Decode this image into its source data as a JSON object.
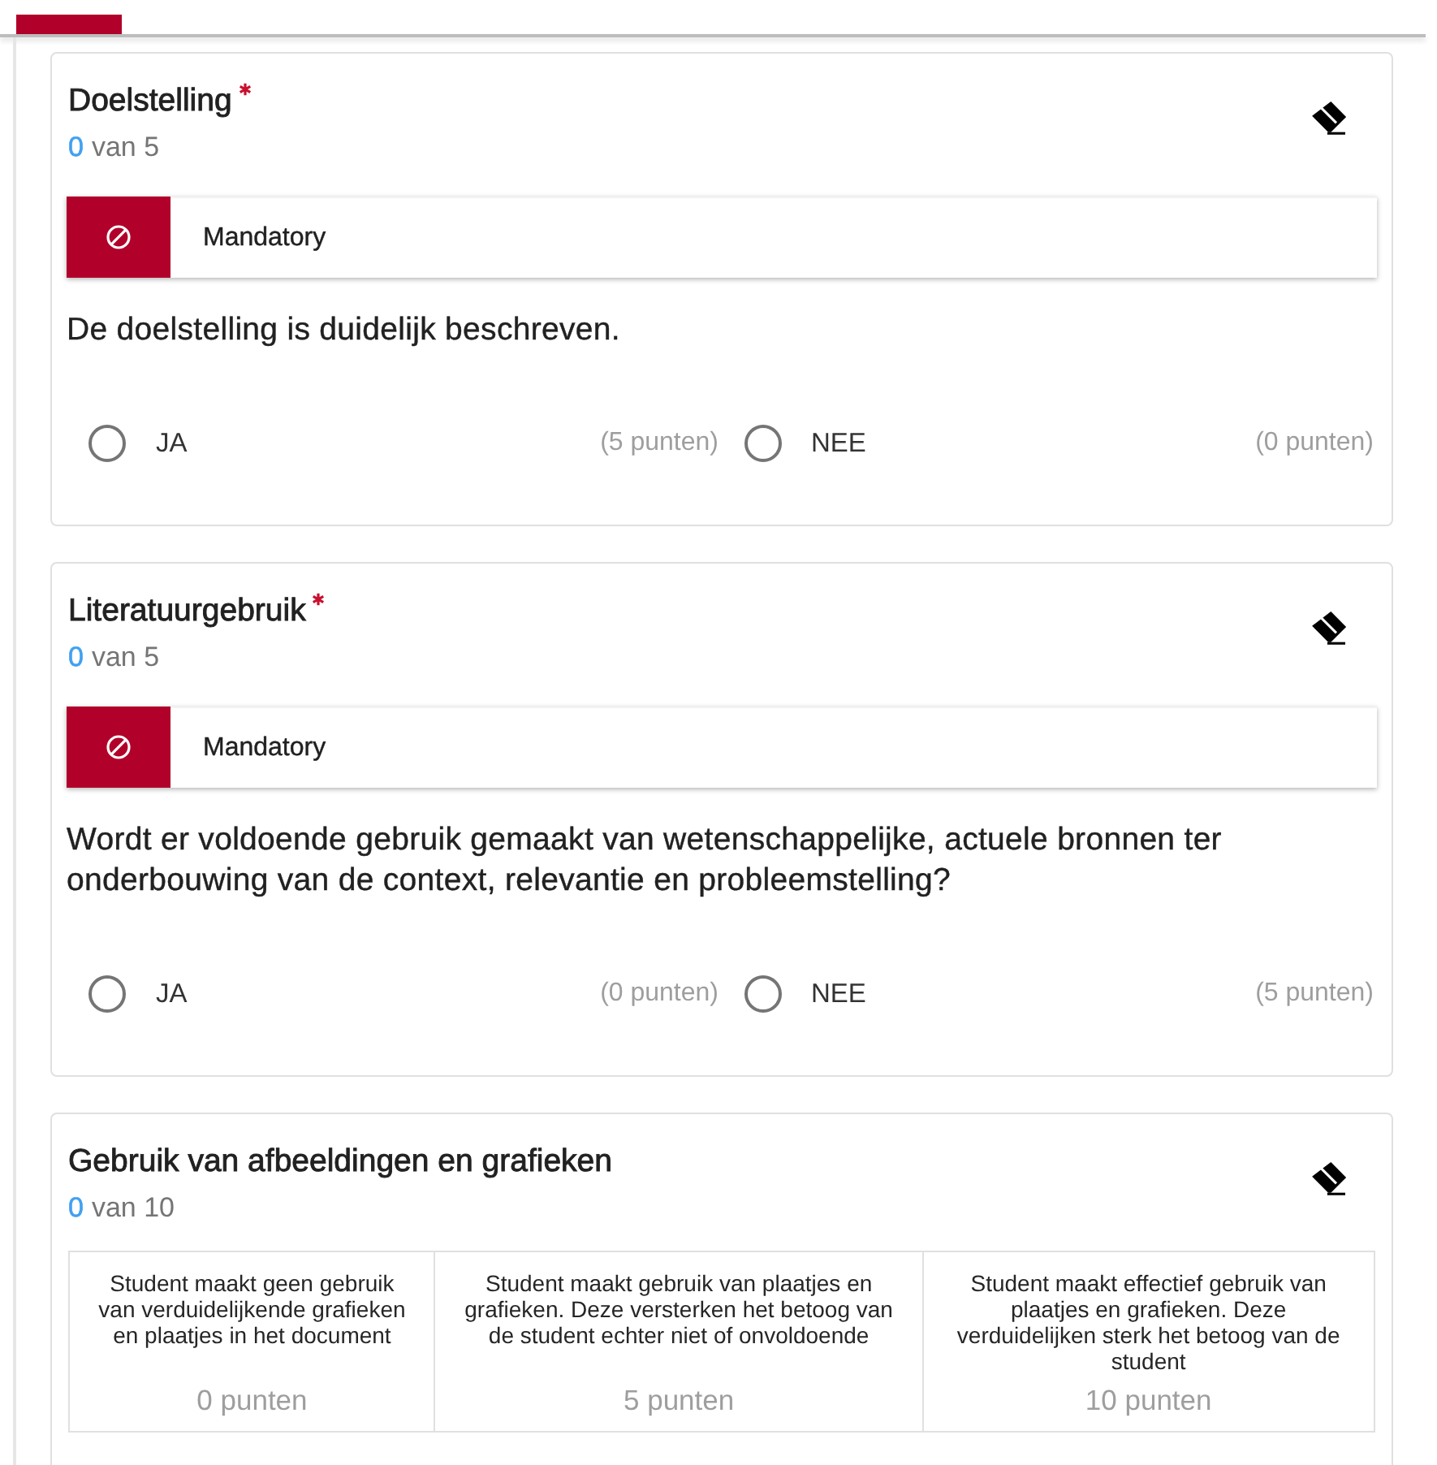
{
  "criteria": [
    {
      "kind": "radio",
      "title": "Doelstelling",
      "required": true,
      "score": "0",
      "max_score": "van 5",
      "notice": "Mandatory",
      "question": "De doelstelling is duidelijk beschreven.",
      "options": [
        {
          "label": "JA",
          "points": "(5 punten)",
          "selected": false
        },
        {
          "label": "NEE",
          "points": "(0 punten)",
          "selected": false
        }
      ]
    },
    {
      "kind": "radio",
      "title": "Literatuurgebruik",
      "required": true,
      "score": "0",
      "max_score": "van 5",
      "notice": "Mandatory",
      "question": "Wordt er voldoende gebruik gemaakt van wetenschappelijke, actuele bronnen ter onderbouwing van de context, relevantie en probleemstelling?",
      "options": [
        {
          "label": "JA",
          "points": "(0 punten)",
          "selected": false
        },
        {
          "label": "NEE",
          "points": "(5 punten)",
          "selected": false
        }
      ]
    },
    {
      "kind": "rubric",
      "title": "Gebruik van afbeeldingen en grafieken",
      "required": false,
      "score": "0",
      "max_score": "van 10",
      "levels": [
        {
          "description": "Student maakt geen gebruik van verduidelijkende grafieken en plaatjes in het document",
          "points": "0 punten",
          "selected": false
        },
        {
          "description": "Student maakt gebruik van plaatjes en grafieken. Deze versterken het betoog van de student echter niet of onvoldoende",
          "points": "5 punten",
          "selected": false
        },
        {
          "description": "Student maakt effectief gebruik van plaatjes en grafieken. Deze verduidelijken sterk het betoog van de student",
          "points": "10 punten",
          "selected": false
        }
      ]
    }
  ]
}
